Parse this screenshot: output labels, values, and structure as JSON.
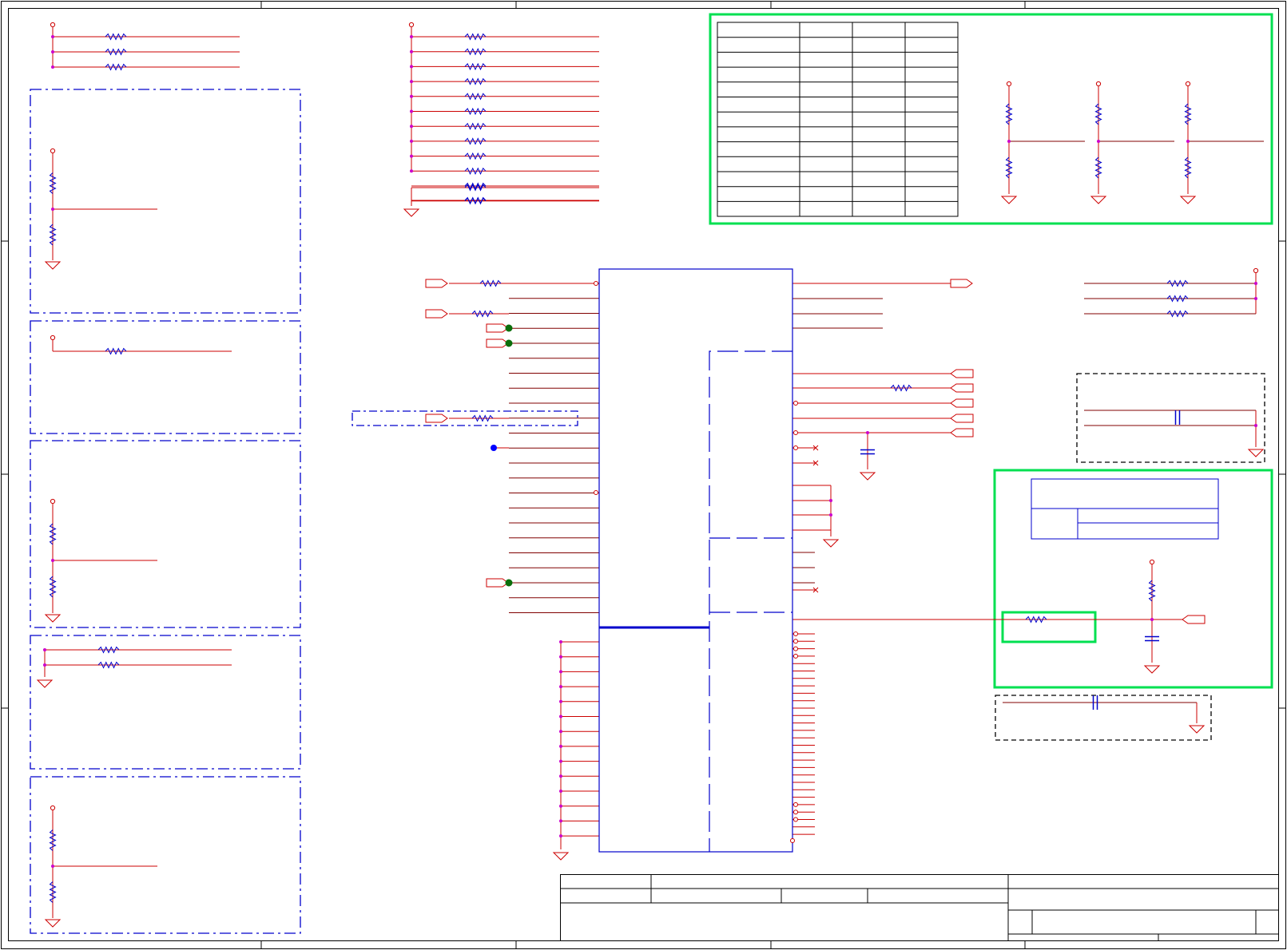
{
  "app": {
    "title": ""
  },
  "colors": {
    "background": "#ffffff",
    "frame": "#000000",
    "wire": "#cc0000",
    "bus_wire": "#800000",
    "component": "#0000cc",
    "junction": "#cc00cc",
    "highlight_box": "#00e050",
    "net_dot_green": "#0b6e0b",
    "net_dot_blue": "#0000ff"
  },
  "diagram": {
    "text_labels": [],
    "icons": [
      "resistor-symbol",
      "capacitor-symbol",
      "ground-symbol",
      "power-port-symbol",
      "off-page-connector-symbol",
      "no-connect-symbol"
    ]
  }
}
